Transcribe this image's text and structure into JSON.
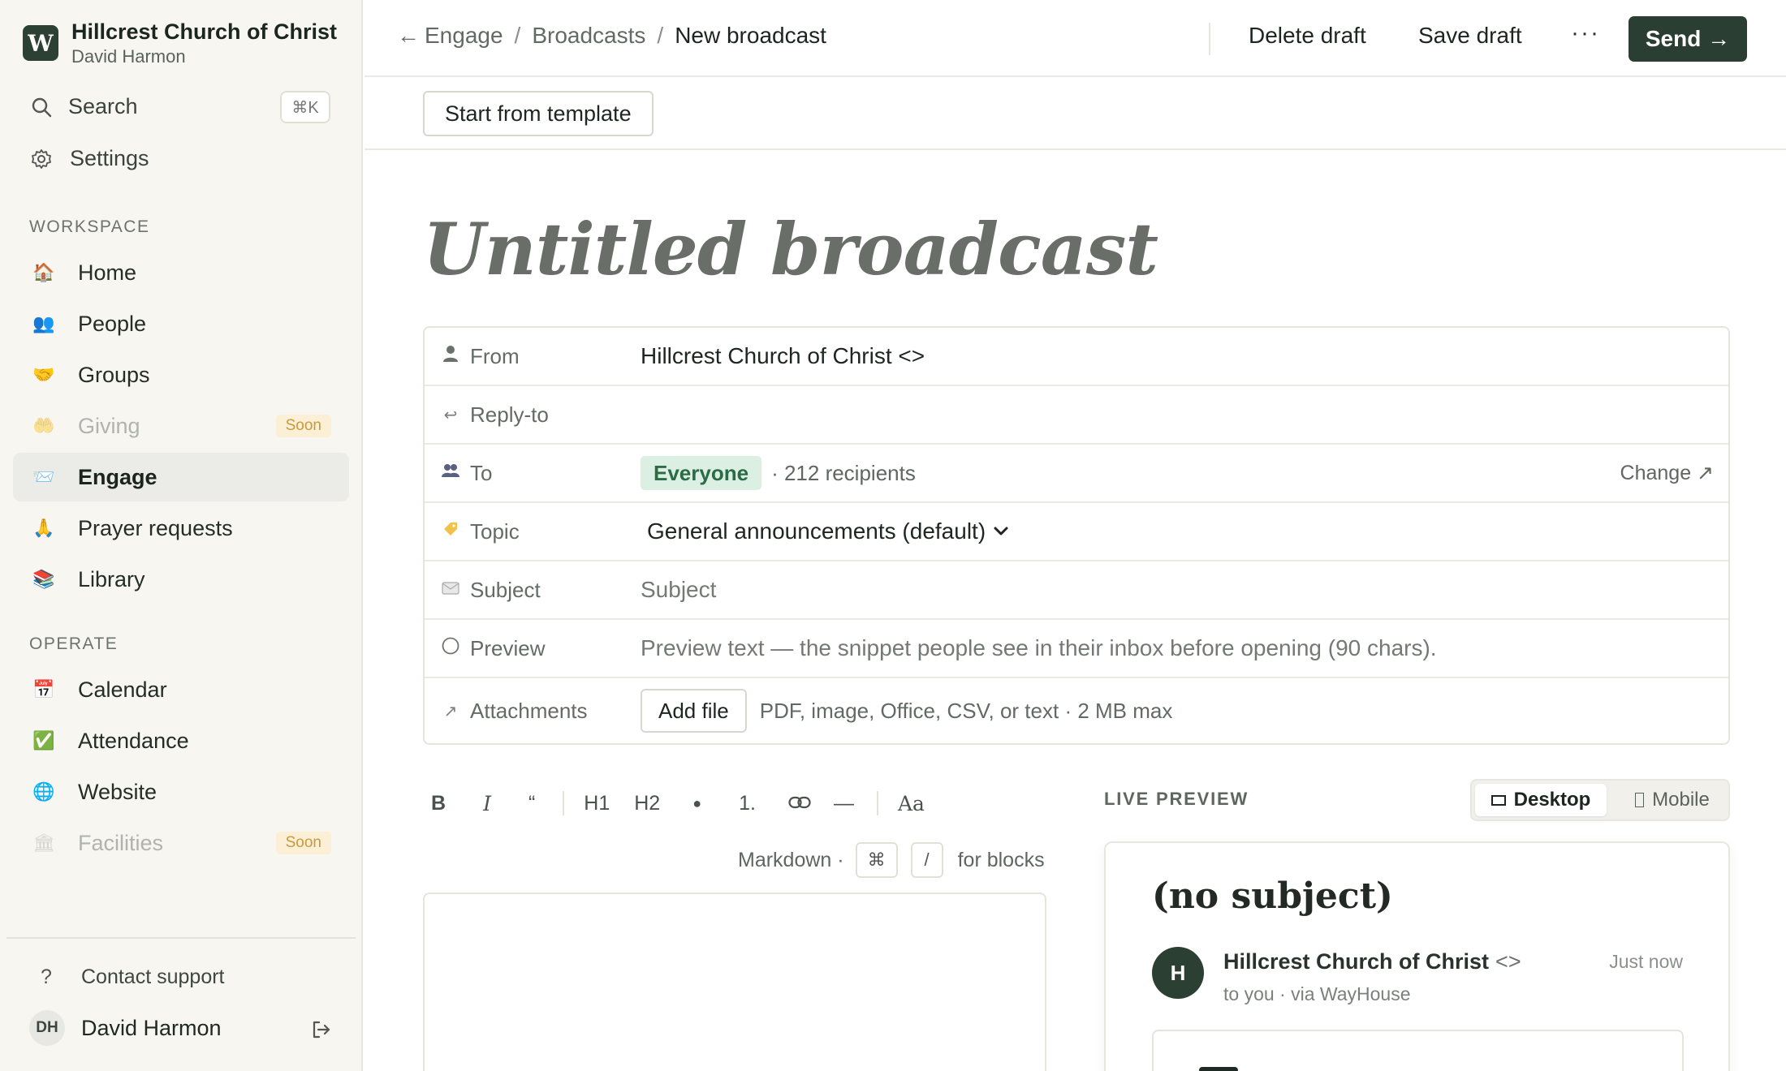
{
  "sidebar": {
    "org_logo": "W",
    "org_name": "Hillcrest Church of Christ",
    "org_user": "David Harmon",
    "search_label": "Search",
    "search_shortcut": "⌘K",
    "settings_label": "Settings",
    "workspace_heading": "WORKSPACE",
    "workspace_items": [
      {
        "label": "Home",
        "icon": "🏠"
      },
      {
        "label": "People",
        "icon": "👥"
      },
      {
        "label": "Groups",
        "icon": "🤝"
      },
      {
        "label": "Giving",
        "icon": "🤲",
        "badge": "Soon"
      },
      {
        "label": "Engage",
        "icon": "📨"
      },
      {
        "label": "Prayer requests",
        "icon": "🙏"
      },
      {
        "label": "Library",
        "icon": "📚"
      }
    ],
    "operate_heading": "OPERATE",
    "operate_items": [
      {
        "label": "Calendar",
        "icon": "📅"
      },
      {
        "label": "Attendance",
        "icon": "✅"
      },
      {
        "label": "Website",
        "icon": "🌐"
      },
      {
        "label": "Facilities",
        "icon": "🏛",
        "badge": "Soon"
      }
    ],
    "support_label": "Contact support",
    "user_initials": "DH",
    "user_name": "David Harmon"
  },
  "topbar": {
    "breadcrumb": [
      "Engage",
      "Broadcasts",
      "New broadcast"
    ],
    "back_arrow": "←",
    "delete_label": "Delete draft",
    "save_label": "Save draft",
    "more_label": "···",
    "send_label": "Send →"
  },
  "template_button": "Start from template",
  "title": "Untitled broadcast",
  "fields": {
    "from_label": "From",
    "from_value": "Hillcrest Church of Christ <>",
    "reply_label": "Reply-to",
    "to_label": "To",
    "to_chip": "Everyone",
    "to_recipients": "· 212 recipients",
    "to_change": "Change ↗",
    "topic_label": "Topic",
    "topic_value": "General announcements (default)",
    "subject_label": "Subject",
    "subject_placeholder": "Subject",
    "preview_label": "Preview",
    "preview_placeholder": "Preview text — the snippet people see in their inbox before opening (90 chars).",
    "attachments_label": "Attachments",
    "add_file_label": "Add file",
    "attachments_hint": "PDF, image, Office, CSV, or text · 2 MB max"
  },
  "toolbar": {
    "bold": "B",
    "italic": "I",
    "quote": "“",
    "h1": "H1",
    "h2": "H2",
    "bullet": "●",
    "numbered": "1.",
    "divider": "—",
    "font": "Aa",
    "markdown_label": "Markdown ·",
    "cmd_key": "⌘",
    "slash_key": "/",
    "blocks_label": "for blocks"
  },
  "preview": {
    "heading": "LIVE PREVIEW",
    "desktop_label": "Desktop",
    "mobile_label": "Mobile",
    "subject": "(no subject)",
    "avatar": "H",
    "from_name": "Hillcrest Church of Christ",
    "from_addr": "<>",
    "to_line": "to you · via WayHouse",
    "time": "Just now"
  }
}
